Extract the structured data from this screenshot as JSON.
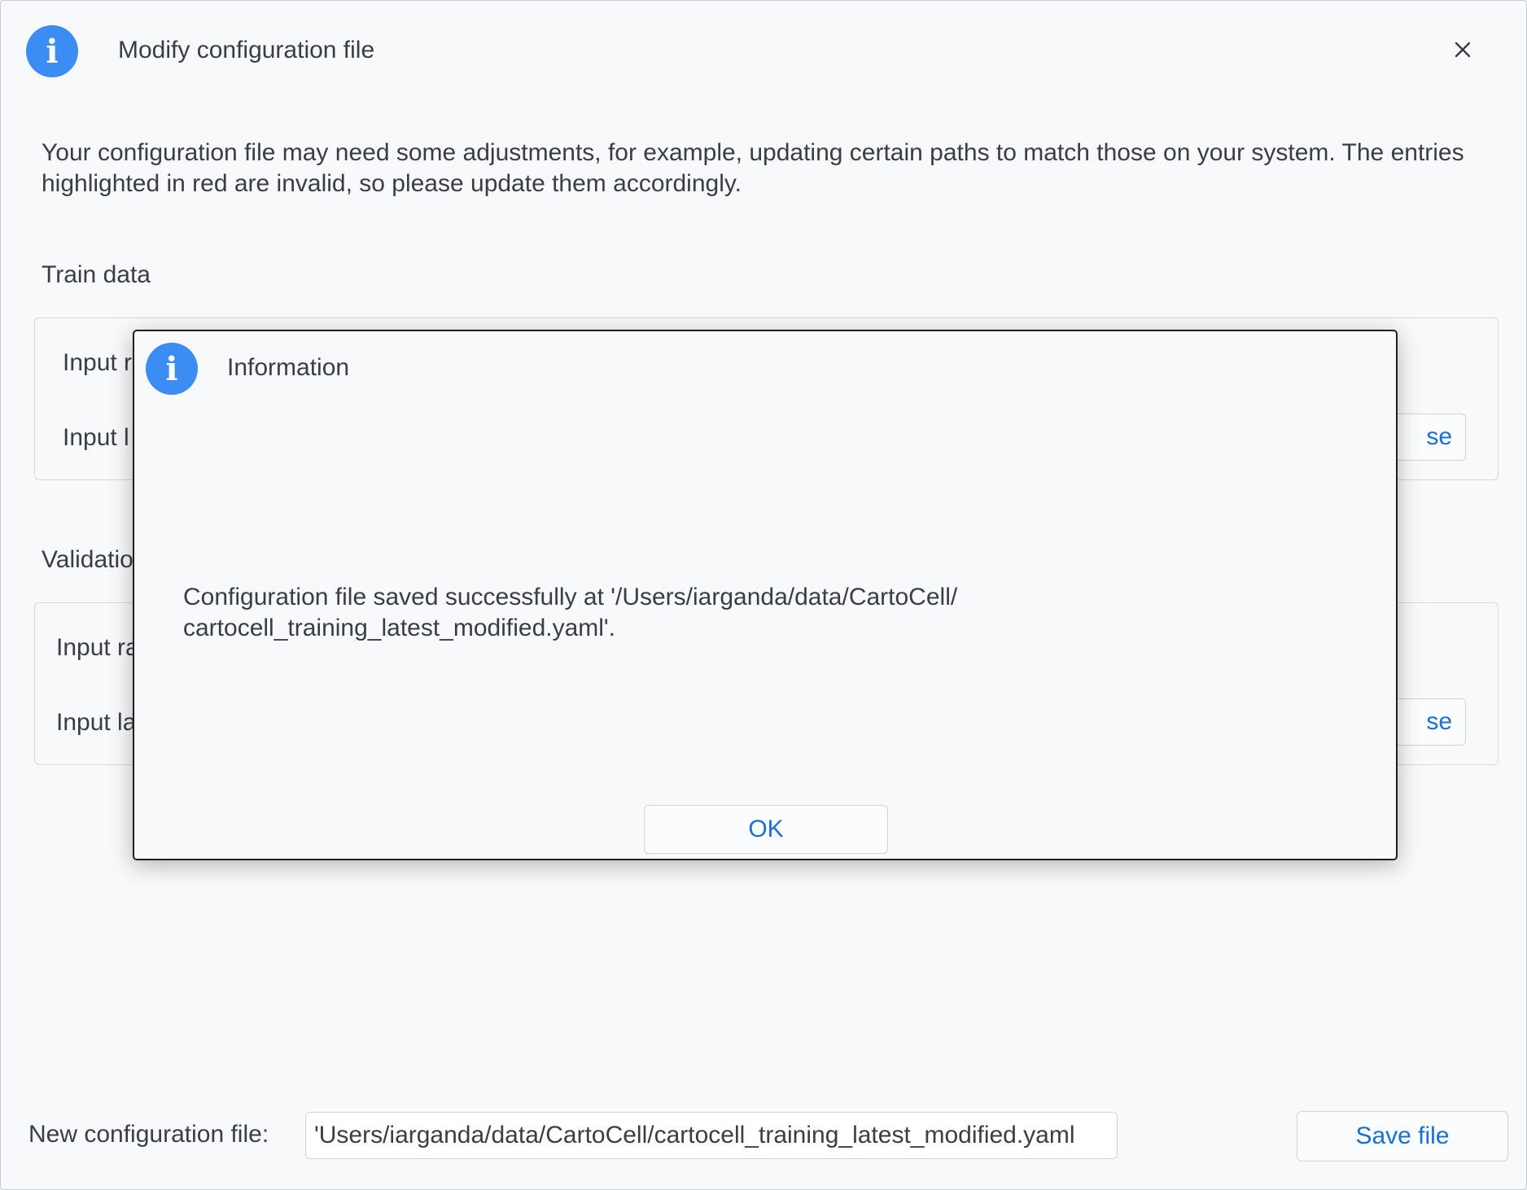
{
  "window": {
    "title": "Modify configuration file",
    "icon": "info-icon",
    "close_icon": "close-icon",
    "description": "Your configuration file may need some adjustments, for example, updating certain paths to match those on your system. The entries highlighted in red are invalid, so please update them accordingly."
  },
  "train": {
    "label": "Train data",
    "raw_label": "Input r",
    "label_label": "Input l",
    "browse_label": "se"
  },
  "validation": {
    "label": "Validatio",
    "raw_label": "Input ra",
    "label_label": "Input la",
    "browse_label": "se"
  },
  "dialog": {
    "title": "Information",
    "icon": "info-icon",
    "message_line1": "Configuration file saved successfully at '/Users/iarganda/data/CartoCell/",
    "message_line2": "cartocell_training_latest_modified.yaml'.",
    "ok_label": "OK"
  },
  "footer": {
    "label": "New configuration file:",
    "file_value": "'Users/iarganda/data/CartoCell/cartocell_training_latest_modified.yaml",
    "save_label": "Save file"
  },
  "colors": {
    "accent": "#3b8cf3",
    "link": "#1a6fd6",
    "background": "#f7f9fb"
  }
}
